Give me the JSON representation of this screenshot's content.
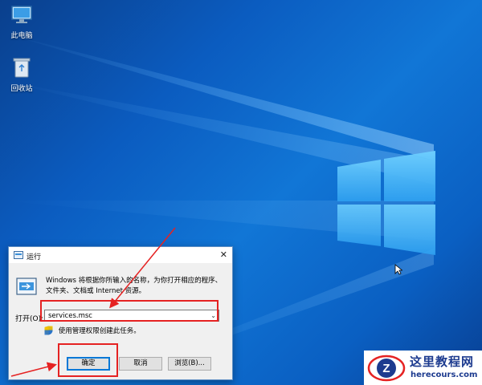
{
  "desktop": {
    "icons": [
      {
        "label": "此电脑",
        "icon": "this-pc-icon"
      },
      {
        "label": "回收站",
        "icon": "recycle-bin-icon"
      }
    ],
    "wallpaper": "windows-10-hero",
    "accent": "#0b63c9"
  },
  "run_dialog": {
    "title": "运行",
    "close_glyph": "✕",
    "description": "Windows 将根据你所输入的名称，为你打开相应的程序、文件夹、文档或 Internet 资源。",
    "open_label": "打开(O):",
    "input_value": "services.msc",
    "admin_note": "使用管理权限创建此任务。",
    "buttons": {
      "ok": "确定",
      "cancel": "取消",
      "browse": "浏览(B)..."
    }
  },
  "annotation_color": "#e52222",
  "watermark": {
    "title": "这里教程网",
    "url": "herecours.com"
  }
}
